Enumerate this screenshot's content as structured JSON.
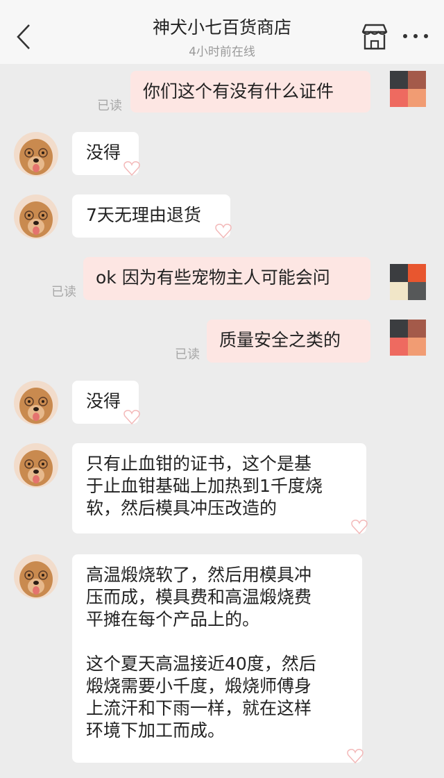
{
  "header": {
    "title": "神犬小七百货商店",
    "status": "4小时前在线"
  },
  "read_label": "已读",
  "messages": {
    "m1": {
      "text": "你们这个有没有什么证件"
    },
    "m2": {
      "text": "没得"
    },
    "m3": {
      "text": "7天无理由退货"
    },
    "m4": {
      "text": "ok 因为有些宠物主人可能会问"
    },
    "m5": {
      "text": "质量安全之类的"
    },
    "m6": {
      "text": "没得"
    },
    "m7": {
      "lines": [
        "只有止血钳的证书，这个是基",
        "于止血钳基础上加热到1千度烧",
        "软，然后模具冲压改造的"
      ]
    },
    "m8": {
      "lines": [
        "高温煅烧软了，然后用模具冲",
        "压而成，模具费和高温煅烧费",
        "平摊在每个产品上的。"
      ],
      "lines2": [
        "这个夏天高温接近40度，然后",
        "煅烧需要小千度，煅烧师傅身",
        "上流汗和下雨一样，就在这样",
        "环境下加工而成。"
      ]
    }
  },
  "colors": {
    "out_bubble": "#fde6e3",
    "in_bubble": "#ffffff",
    "background": "#ececec"
  }
}
